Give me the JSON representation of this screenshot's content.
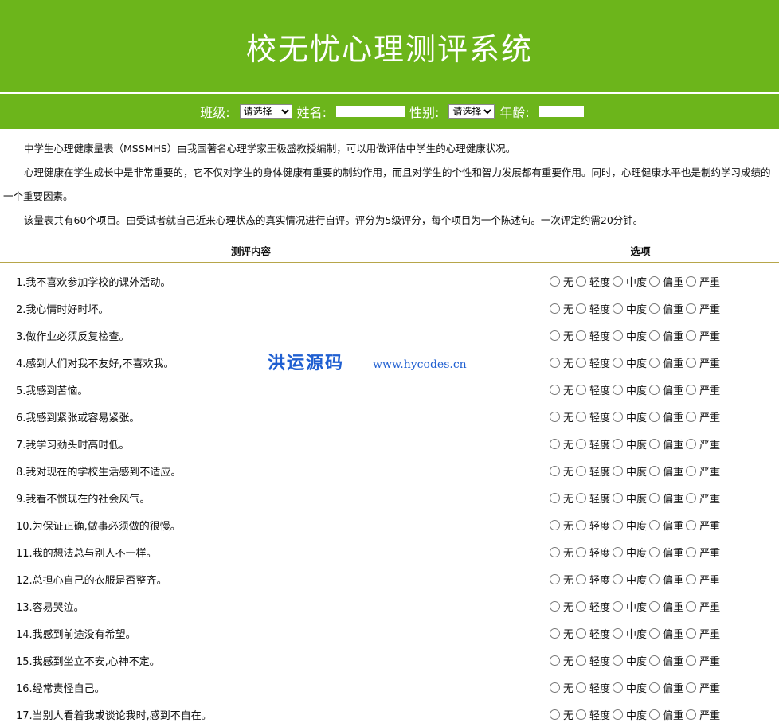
{
  "header": {
    "title": "校无忧心理测评系统"
  },
  "infobar": {
    "class_label": "班级:",
    "class_select": "请选择",
    "name_label": "姓名:",
    "gender_label": "性别:",
    "gender_select": "请选择",
    "age_label": "年龄:"
  },
  "intro": {
    "p1": "中学生心理健康量表（MSSMHS）由我国著名心理学家王极盛教授编制，可以用做评估中学生的心理健康状况。",
    "p2": "心理健康在学生成长中是非常重要的，它不仅对学生的身体健康有重要的制约作用，而且对学生的个性和智力发展都有重要作用。同时，心理健康水平也是制约学习成绩的一个重要因素。",
    "p3": "该量表共有60个项目。由受试者就自己近来心理状态的真实情况进行自评。评分为5级评分，每个项目为一个陈述句。一次评定约需20分钟。"
  },
  "table": {
    "col_content": "测评内容",
    "col_options": "选项",
    "options": [
      "无",
      "轻度",
      "中度",
      "偏重",
      "严重"
    ],
    "questions": [
      "1.我不喜欢参加学校的课外活动。",
      "2.我心情时好时坏。",
      "3.做作业必须反复检查。",
      "4.感到人们对我不友好,不喜欢我。",
      "5.我感到苦恼。",
      "6.我感到紧张或容易紧张。",
      "7.我学习劲头时高时低。",
      "8.我对现在的学校生活感到不适应。",
      "9.我看不惯现在的社会风气。",
      "10.为保证正确,做事必须做的很慢。",
      "11.我的想法总与别人不一样。",
      "12.总担心自己的衣服是否整齐。",
      "13.容易哭泣。",
      "14.我感到前途没有希望。",
      "15.我感到坐立不安,心神不定。",
      "16.经常责怪自己。",
      "17.当别人看着我或谈论我时,感到不自在。"
    ]
  },
  "watermark": {
    "brand": "洪运源码",
    "url": "www.hycodes.cn"
  }
}
